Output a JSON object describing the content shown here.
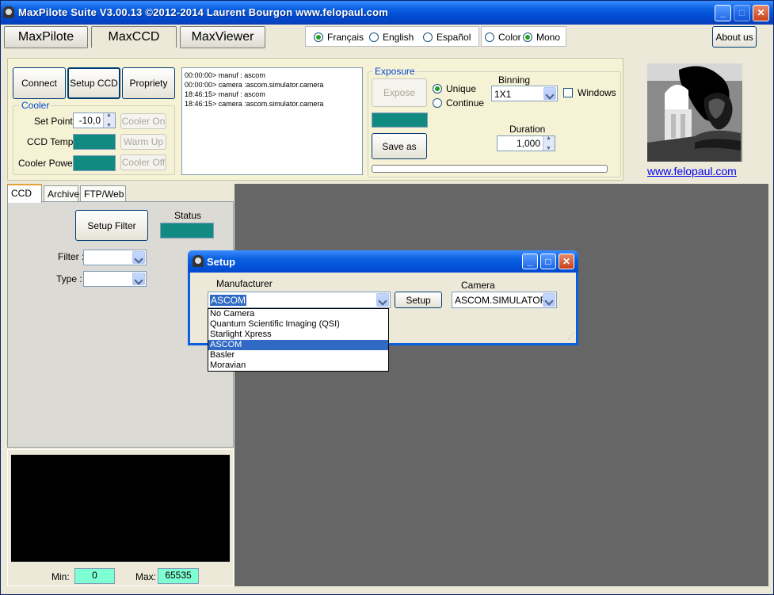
{
  "window": {
    "title": "MaxPilote Suite  V3.00.13  ©2012-2014 Laurent Bourgon  www.felopaul.com",
    "buttons": {
      "minimize": "_",
      "maximize": "□",
      "close": "✕"
    }
  },
  "main_tabs": [
    "MaxPilote",
    "MaxCCD",
    "MaxViewer"
  ],
  "language": {
    "options": [
      "Français",
      "English",
      "Español"
    ],
    "selected": "Français"
  },
  "color_mode": {
    "options": [
      "Color",
      "Mono"
    ],
    "selected": "Mono"
  },
  "about_label": "About us",
  "toolbar": {
    "connect": "Connect",
    "setup_ccd": "Setup CCD",
    "propriety": "Propriety"
  },
  "cooler": {
    "legend": "Cooler",
    "set_point_label": "Set Point",
    "set_point_value": "-10,0",
    "ccd_temp_label": "CCD Temp",
    "cooler_power_label": "Cooler Power",
    "cooler_on": "Cooler On",
    "warm_up": "Warm Up",
    "cooler_off": "Cooler Off"
  },
  "log": [
    "00:00:00> manuf : ascom",
    "00:00:00> camera :ascom.simulator.camera",
    "18:46:15> manuf : ascom",
    "18:46:15> camera :ascom.simulator.camera"
  ],
  "exposure": {
    "legend": "Exposure",
    "expose": "Expose",
    "save_as": "Save as",
    "unique": "Unique",
    "continue": "Continue",
    "binning_label": "Binning",
    "binning_value": "1X1",
    "windows_label": "Windows",
    "duration_label": "Duration",
    "duration_value": "1,000",
    "progress": 0
  },
  "website_link": "www.felopaul.com",
  "sub_tabs": [
    "CCD",
    "Archive",
    "FTP/Web"
  ],
  "ccd_tab": {
    "setup_filter": "Setup Filter",
    "status_label": "Status",
    "filter_label": "Filter :",
    "type_label": "Type :"
  },
  "histogram": {
    "min_label": "Min:",
    "min_value": "0",
    "max_label": "Max:",
    "max_value": "65535"
  },
  "setup_dialog": {
    "title": "Setup",
    "manufacturer_label": "Manufacturer",
    "manufacturer_value": "ASCOM",
    "setup_button": "Setup",
    "camera_label": "Camera",
    "camera_value": "ASCOM.SIMULATOR.",
    "manufacturer_options": [
      "No Camera",
      "Quantum Scientific Imaging (QSI)",
      "Starlight Xpress",
      "ASCOM",
      "Basler",
      "Moravian"
    ],
    "selected_index": 3
  },
  "colors": {
    "teal": "#118a82",
    "mint": "#7fffd4",
    "titlebar": "#0a5fe0",
    "viewer_bg": "#666666"
  }
}
